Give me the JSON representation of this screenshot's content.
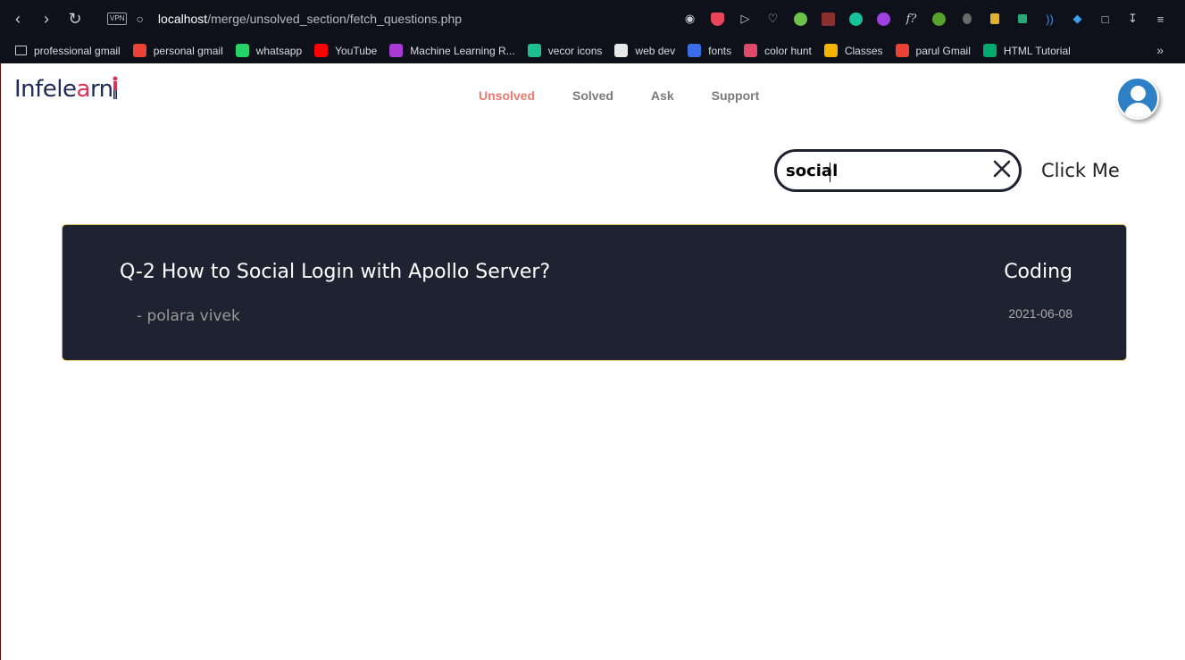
{
  "browser": {
    "url_host": "localhost",
    "url_path": "/merge/unsolved_section/fetch_questions.php",
    "vpn_label": "VPN",
    "ext_icons": [
      "camera-icon",
      "shield-icon",
      "send-icon",
      "heart-icon",
      "extension-icon",
      "extension-icon",
      "grammarly-icon",
      "extension-icon",
      "font-icon",
      "tree-icon",
      "bug-icon",
      "extension-icon",
      "pen-icon",
      "wifi-icon",
      "diamond-icon",
      "cube-icon",
      "download-icon",
      "menu-icon"
    ],
    "font_ext_label": "f?",
    "bookmarks": [
      {
        "label": "professional gmail",
        "icon": "folder-icon",
        "color": "#0f111a"
      },
      {
        "label": "personal gmail",
        "icon": "gmail-icon",
        "color": "#ea4335"
      },
      {
        "label": "whatsapp",
        "icon": "whatsapp-icon",
        "color": "#25d366"
      },
      {
        "label": "YouTube",
        "icon": "youtube-icon",
        "color": "#ff0000"
      },
      {
        "label": "Machine Learning R...",
        "icon": "m-icon",
        "color": "#a83ad6"
      },
      {
        "label": "vecor icons",
        "icon": "vector-icon",
        "color": "#1fbf8f"
      },
      {
        "label": "web dev",
        "icon": "webdev-icon",
        "color": "#e8e8e8"
      },
      {
        "label": "fonts",
        "icon": "fonts-icon",
        "color": "#3a6ee8"
      },
      {
        "label": "color hunt",
        "icon": "colorhunt-icon",
        "color": "#e04a6a"
      },
      {
        "label": "Classes",
        "icon": "classroom-icon",
        "color": "#f4b400"
      },
      {
        "label": "parul Gmail",
        "icon": "gmail-icon",
        "color": "#ea4335"
      },
      {
        "label": "HTML Tutorial",
        "icon": "w3-icon",
        "color": "#04aa6d"
      }
    ],
    "more_label": "»"
  },
  "site": {
    "logo_text": "Infele",
    "logo_o": "a",
    "logo_rest": "rn",
    "nav": [
      {
        "label": "Unsolved",
        "active": true
      },
      {
        "label": "Solved",
        "active": false
      },
      {
        "label": "Ask",
        "active": false
      },
      {
        "label": "Support",
        "active": false
      }
    ]
  },
  "search": {
    "value": "social",
    "button_label": "Click Me"
  },
  "questions": [
    {
      "title": "Q-2 How to Social Login with Apollo Server?",
      "author": "- polara vivek",
      "category": "Coding",
      "date": "2021-06-08"
    }
  ],
  "colors": {
    "card_bg": "#1f2331",
    "card_border": "#d9c35a",
    "nav_active": "#f07a6f",
    "avatar_bg": "#2d7fc6"
  }
}
